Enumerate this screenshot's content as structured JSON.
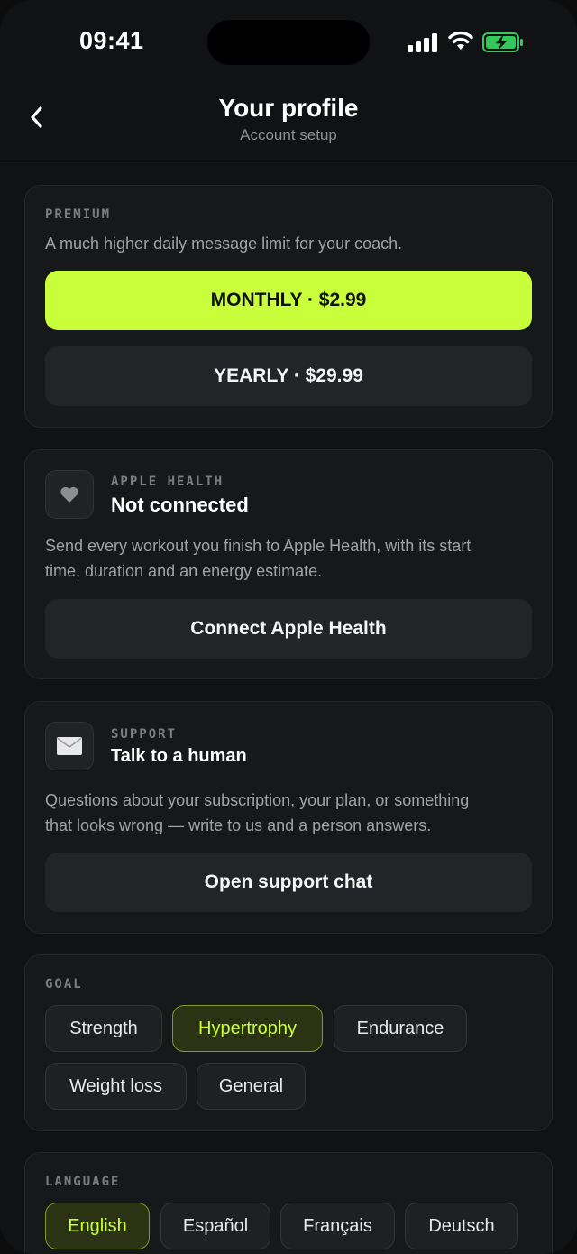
{
  "status_bar": {
    "time": "09:41"
  },
  "header": {
    "title": "Your profile",
    "subtitle": "Account setup",
    "back_icon": "chevron-left-icon"
  },
  "premium": {
    "eyebrow": "PREMIUM",
    "description": "A much higher daily message limit for your coach.",
    "monthly_label": "MONTHLY · $2.99",
    "yearly_label": "YEARLY · $29.99",
    "accent_color": "#c8ff3a"
  },
  "apple_health": {
    "eyebrow": "APPLE HEALTH",
    "status": "Not connected",
    "description_line1": "Send every workout you finish to Apple Health, with its start",
    "description_line2": "time, duration and an energy estimate.",
    "button_label": "Connect Apple Health",
    "icon": "heart-icon"
  },
  "support": {
    "eyebrow": "SUPPORT",
    "title": "Talk to a human",
    "description_line1": "Questions about your subscription, your plan, or something",
    "description_line2": "that looks wrong — write to us and a person answers.",
    "button_label": "Open support chat",
    "icon": "envelope-icon"
  },
  "goal": {
    "eyebrow": "GOAL",
    "options": [
      "Strength",
      "Hypertrophy",
      "Endurance",
      "Weight loss",
      "General"
    ],
    "selected": "Hypertrophy"
  },
  "language": {
    "eyebrow": "LANGUAGE",
    "options": [
      "English",
      "Español",
      "Français",
      "Deutsch"
    ],
    "selected": "English"
  }
}
